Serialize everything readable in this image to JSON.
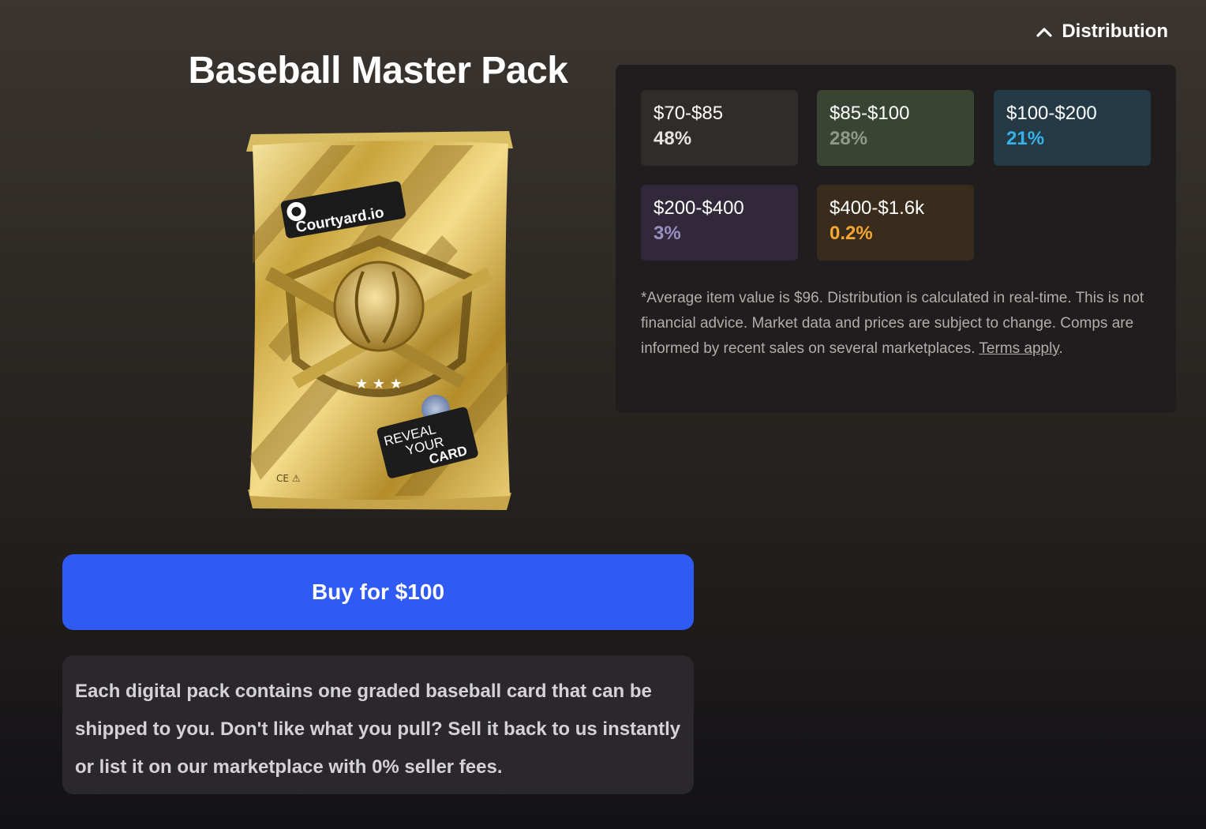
{
  "pack": {
    "title": "Baseball Master Pack",
    "image_alt": "Courtyard.io gold baseball pack",
    "brand_text": "Courtyard.io",
    "reveal_text": [
      "REVEAL",
      "YOUR",
      "CARD"
    ],
    "ce_mark": "CE ⚠"
  },
  "buy_button": {
    "label": "Buy for $100"
  },
  "description": "Each digital pack contains one graded baseball card that can be shipped to you. Don't like what you pull? Sell it back to us instantly or list it on our marketplace with 0% seller fees.",
  "distribution": {
    "toggle_label": "Distribution",
    "toggle_icon": "chevron-up-icon",
    "tiers": [
      {
        "range": "$70-$85",
        "percent": "48%",
        "bg": "#302c2a",
        "color": "#e5e3e1"
      },
      {
        "range": "$85-$100",
        "percent": "28%",
        "bg": "#394532",
        "color": "#8d9a85"
      },
      {
        "range": "$100-$200",
        "percent": "21%",
        "bg": "#243a46",
        "color": "#38b3e9"
      },
      {
        "range": "$200-$400",
        "percent": "3%",
        "bg": "#31293a",
        "color": "#9b8ec3"
      },
      {
        "range": "$400-$1.6k",
        "percent": "0.2%",
        "bg": "#3a2c1c",
        "color": "#f7a832"
      }
    ],
    "disclaimer_text": "*Average item value is $96. Distribution is calculated in real-time. This is not financial advice. Market data and prices are subject to change. Comps are informed by recent sales on several marketplaces. ",
    "terms_link": "Terms apply",
    "disclaimer_end": "."
  }
}
